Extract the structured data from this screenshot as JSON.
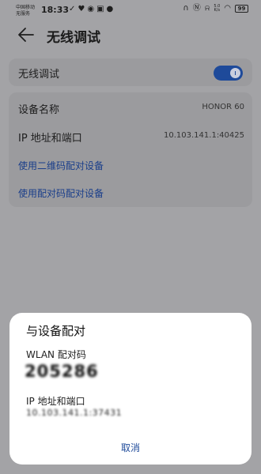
{
  "status_bar": {
    "carrier_line1": "中国移动",
    "carrier_line2": "无服务",
    "time": "18:33",
    "net_speed_value": "5.0",
    "net_speed_unit": "K/s",
    "battery": "99"
  },
  "header": {
    "title": "无线调试"
  },
  "toggle_card": {
    "label": "无线调试",
    "enabled": true
  },
  "info_card": {
    "device_name_label": "设备名称",
    "device_name_value": "HONOR 60",
    "ip_label": "IP 地址和端口",
    "ip_value": "10.103.141.1:40425",
    "pair_qr_link": "使用二维码配对设备",
    "pair_code_link": "使用配对码配对设备"
  },
  "dialog": {
    "title": "与设备配对",
    "wlan_code_label": "WLAN 配对码",
    "wlan_code_value": "205286",
    "ip_label": "IP 地址和端口",
    "ip_value": "10.103.141.1:37431",
    "cancel_label": "取消"
  },
  "colors": {
    "accent": "#1e4a9a",
    "link": "#1a3e8a",
    "overlay_bg": "#a3a3a6",
    "card_bg": "#9b9b9e",
    "dialog_bg": "#ffffff"
  }
}
